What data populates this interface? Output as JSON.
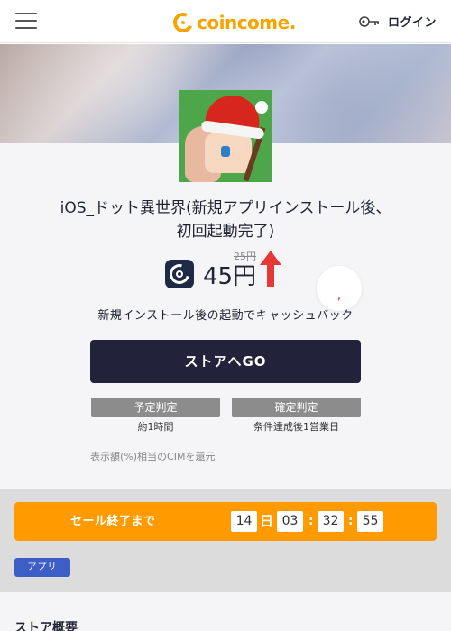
{
  "header": {
    "logo_text": "coincome.",
    "login_label": "ログイン"
  },
  "app": {
    "title": "iOS_ドット異世界(新規アプリインストール後、初回起動完了)",
    "old_price": "25円",
    "new_price": "45円",
    "badge_text": ",",
    "subtext": "新規インストール後の起動でキャッシュバック"
  },
  "actions": {
    "store_button": "ストアへGO"
  },
  "judgements": [
    {
      "label": "予定判定",
      "value": "約1時間"
    },
    {
      "label": "確定判定",
      "value": "条件達成後1営業日"
    }
  ],
  "note": "表示額(%)相当のCIMを還元",
  "sale": {
    "label": "セール終了まで",
    "days": "14",
    "day_unit": "日",
    "hours": "03",
    "minutes": "32",
    "seconds": "55",
    "separator": ":"
  },
  "tags": {
    "app": "アプリ"
  },
  "sections": {
    "store_overview": "ストア概要"
  },
  "colors": {
    "accent": "#f7a400",
    "primary_dark": "#22233b",
    "sale_orange": "#ff9a00",
    "tag_blue": "#3d5ec7",
    "arrow_red": "#e53935"
  }
}
